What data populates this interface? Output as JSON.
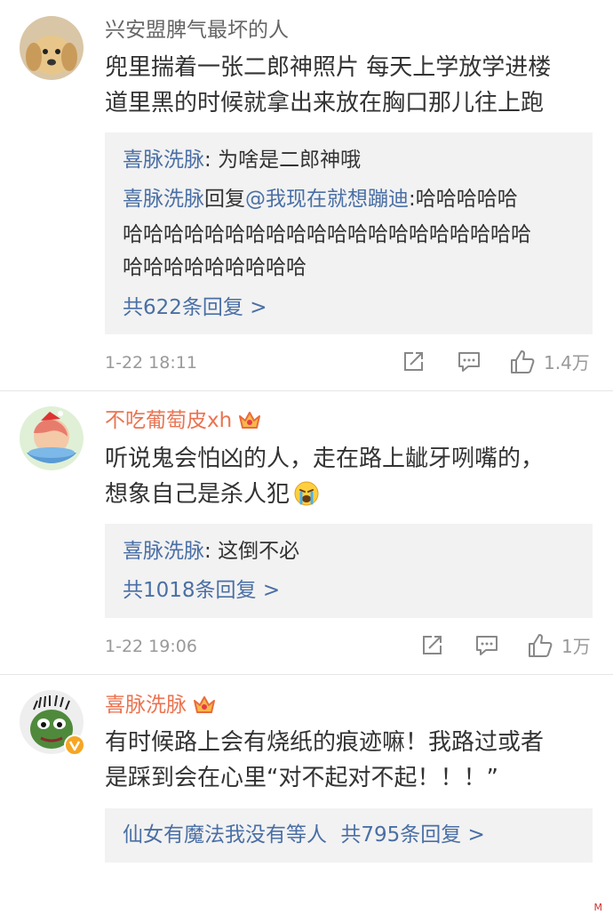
{
  "comments": [
    {
      "username": "兴安盟脾气最坏的人",
      "text_lines": [
        "兜里揣着一张二郎神照片 每天上学放学进楼",
        "道里黑的时候就拿出来放在胸口那儿往上跑"
      ],
      "replies": [
        {
          "author": "喜脉洗脉",
          "sep": ": ",
          "text": "为啥是二郎神哦"
        },
        {
          "author": "喜脉洗脉",
          "reply_word": "回复",
          "mention": "@我现在就想蹦迪",
          "sep": ":",
          "text_lines": [
            "哈哈哈哈哈",
            "哈哈哈哈哈哈哈哈哈哈哈哈哈哈哈哈哈哈哈哈",
            "哈哈哈哈哈哈哈哈哈"
          ]
        }
      ],
      "more_replies": "共622条回复 >",
      "time": "1-22 18:11",
      "likes": "1.4万"
    },
    {
      "username": "不吃葡萄皮xh",
      "text_lines": [
        "听说鬼会怕凶的人，走在路上龇牙咧嘴的，",
        "想象自己是杀人犯"
      ],
      "replies": [
        {
          "author": "喜脉洗脉",
          "sep": ": ",
          "text": "这倒不必"
        }
      ],
      "more_replies": "共1018条回复 >",
      "time": "1-22 19:06",
      "likes": "1万"
    },
    {
      "username": "喜脉洗脉",
      "text_lines": [
        "有时候路上会有烧纸的痕迹嘛！我路过或者",
        "是踩到会在心里“对不起对不起！！！”"
      ],
      "reply_preview_user": "仙女有魔法我没有等人",
      "more_replies": "共795条回复 >"
    }
  ],
  "icons": {
    "share": "share-icon",
    "comment": "comment-icon",
    "like": "thumbs-up-icon",
    "crown": "crown-badge-icon"
  },
  "colors": {
    "username_orange": "#eb7350",
    "link_blue": "#4a6fa5",
    "reply_bg": "#f2f2f2"
  },
  "watermark": "M"
}
